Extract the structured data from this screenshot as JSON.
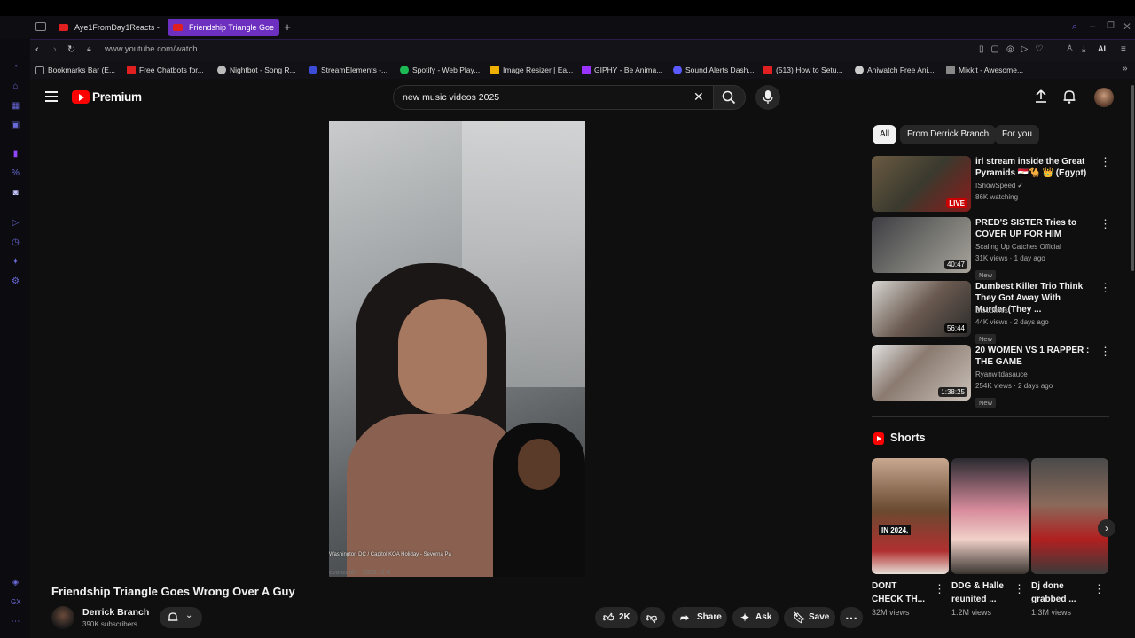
{
  "browser": {
    "tabs": [
      {
        "label": "Aye1FromDay1Reacts - Yo"
      },
      {
        "label": "Friendship Triangle Goe"
      }
    ],
    "new_tab": "+",
    "url": "www.youtube.com/watch",
    "ai_label": "AI",
    "bookmarks": [
      {
        "label": "Bookmarks Bar (E...",
        "color": "#8a8a8a"
      },
      {
        "label": "Free Chatbots for...",
        "color": "#e02020"
      },
      {
        "label": "Nightbot - Song R...",
        "color": "#bbbbbb"
      },
      {
        "label": "StreamElements -...",
        "color": "#3c4cd6"
      },
      {
        "label": "Spotify - Web Play...",
        "color": "#1db954"
      },
      {
        "label": "Image Resizer | Ea...",
        "color": "#f0b000"
      },
      {
        "label": "GIPHY - Be Anima...",
        "color": "#9933ff"
      },
      {
        "label": "Sound Alerts Dash...",
        "color": "#5a5aff"
      },
      {
        "label": "(513) How to Setu...",
        "color": "#e02020"
      },
      {
        "label": "Aniwatch Free Ani...",
        "color": "#cccccc"
      },
      {
        "label": "Mixkit - Awesome...",
        "color": "#888888"
      }
    ]
  },
  "youtube": {
    "logo_text": "Premium",
    "search_value": "new music videos 2025",
    "video": {
      "title": "Friendship Triangle Goes Wrong Over A Guy",
      "channel": "Derrick Branch",
      "subscribers": "390K subscribers",
      "overlay_location": "Washington DC / Capitol KOA Holiday - Severna Pa",
      "overlay_user": "evonceshi · 2025-11-4",
      "likes": "2K",
      "share": "Share",
      "ask": "Ask",
      "save": "Save"
    },
    "chips": [
      "All",
      "From Derrick Branch",
      "For you"
    ],
    "recommendations": [
      {
        "title": "irl stream inside the Great Pyramids 🇪🇬🐪 👑 (Egypt)",
        "channel": "IShowSpeed",
        "meta": "86K watching",
        "badge": "LIVE",
        "new": ""
      },
      {
        "title": "PRED'S SISTER Tries to COVER UP FOR HIM",
        "channel": "Scaling Up Catches Official",
        "meta": "31K views · 1 day ago",
        "badge": "40:47",
        "new": "New"
      },
      {
        "title": "Dumbest Killer Trio Think They Got Away With Murder (They ...",
        "channel": "Bloodlines",
        "meta": "44K views · 2 days ago",
        "badge": "56:44",
        "new": "New"
      },
      {
        "title": "20 WOMEN VS 1 RAPPER : THE GAME",
        "channel": "Ryanwitdasauce",
        "meta": "254K views · 2 days ago",
        "badge": "1:38:25",
        "new": "New"
      }
    ],
    "shorts_heading": "Shorts",
    "shorts": [
      {
        "title": "DONT CHECK TH...",
        "views": "32M views",
        "thumb_text": "IN 2024,"
      },
      {
        "title": "DDG & Halle reunited ...",
        "views": "1.2M views",
        "thumb_text": ""
      },
      {
        "title": "Dj done grabbed ...",
        "views": "1.3M views",
        "thumb_text": ""
      }
    ]
  }
}
